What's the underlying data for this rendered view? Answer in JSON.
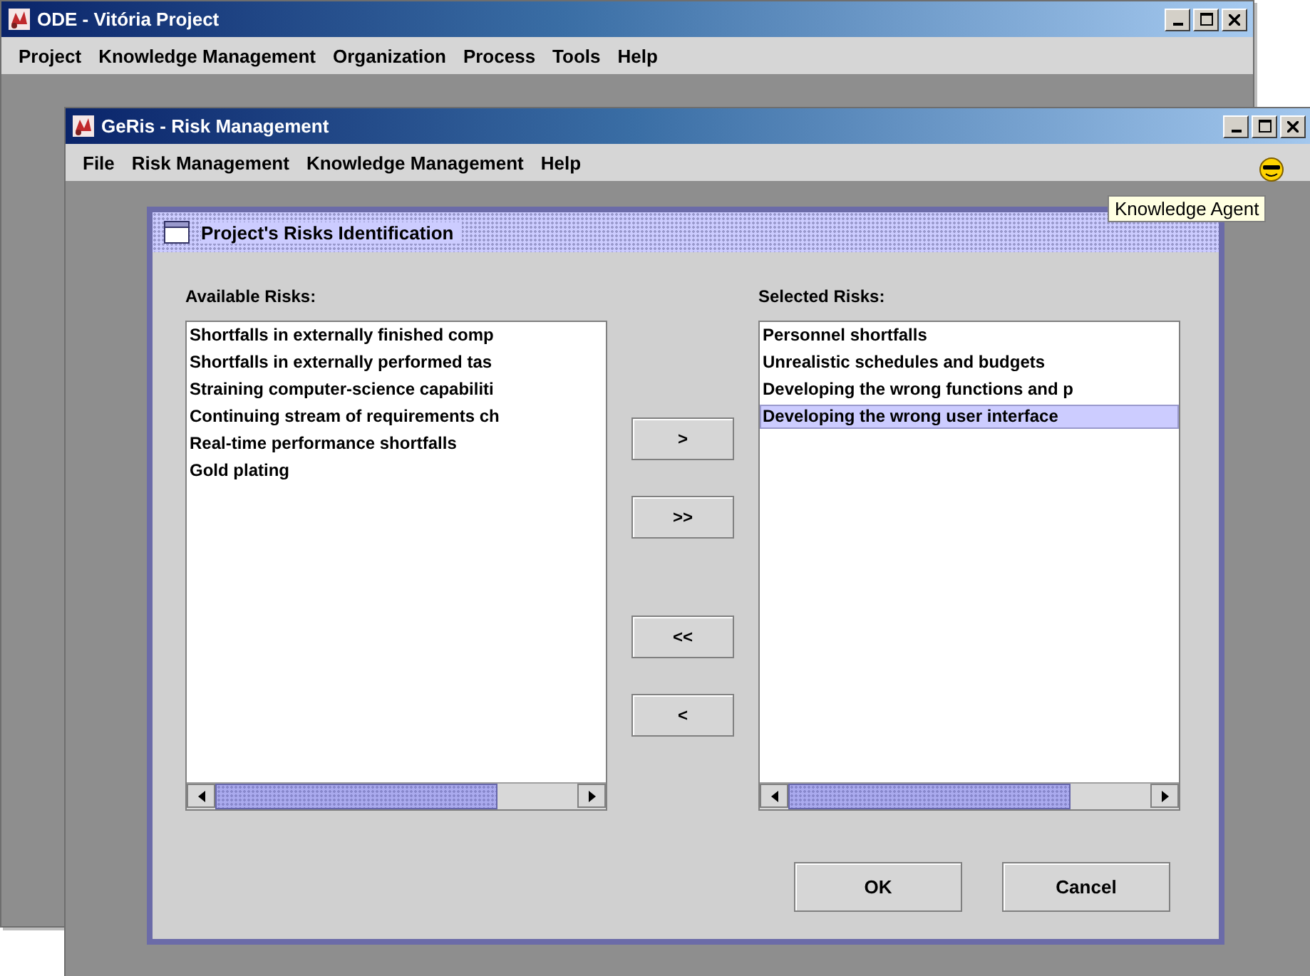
{
  "main_window": {
    "title": "ODE - Vitória Project",
    "menu": [
      "Project",
      "Knowledge Management",
      "Organization",
      "Process",
      "Tools",
      "Help"
    ]
  },
  "child_window": {
    "title": "GeRis - Risk Management",
    "menu": [
      "File",
      "Risk Management",
      "Knowledge Management",
      "Help"
    ],
    "tooltip": "Knowledge Agent"
  },
  "dialog": {
    "title": "Project's Risks Identification",
    "available": {
      "label": "Available Risks:",
      "items": [
        {
          "text": "Shortfalls in externally finished comp",
          "selected": false
        },
        {
          "text": "Shortfalls in externally performed tas",
          "selected": false
        },
        {
          "text": "Straining computer-science capabiliti",
          "selected": false
        },
        {
          "text": "Continuing stream of requirements ch",
          "selected": false
        },
        {
          "text": "Real-time performance shortfalls",
          "selected": false
        },
        {
          "text": "Gold plating",
          "selected": false
        }
      ]
    },
    "selected": {
      "label": "Selected Risks:",
      "items": [
        {
          "text": "Personnel shortfalls",
          "selected": false
        },
        {
          "text": "Unrealistic schedules and budgets",
          "selected": false
        },
        {
          "text": "Developing the wrong functions and p",
          "selected": false
        },
        {
          "text": "Developing the wrong user interface",
          "selected": true
        }
      ]
    },
    "transfer_buttons": [
      ">",
      ">>",
      "<<",
      "<"
    ],
    "buttons": [
      "OK",
      "Cancel"
    ]
  }
}
